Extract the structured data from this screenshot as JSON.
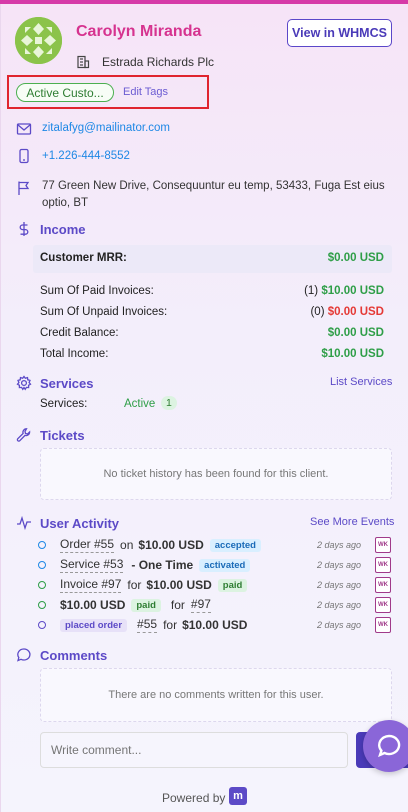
{
  "client": {
    "name": "Carolyn Miranda",
    "company": "Estrada Richards Plc",
    "view_button": "View in WHMCS",
    "tag": "Active Custo...",
    "edit_tags": "Edit Tags",
    "email": "zitalafyg@mailinator.com",
    "phone": "+1.226-444-8552",
    "address": "77 Green New Drive, Consequuntur eu temp, 53433, Fuga Est eius optio, BT"
  },
  "income": {
    "title": "Income",
    "mrr_label": "Customer MRR:",
    "mrr_value": "$0.00 USD",
    "rows": [
      {
        "label": "Sum Of Paid Invoices:",
        "count": "(1)",
        "value": "$10.00 USD",
        "color": "#2e9e47"
      },
      {
        "label": "Sum Of Unpaid Invoices:",
        "count": "(0)",
        "value": "$0.00 USD",
        "color": "#e53935"
      },
      {
        "label": "Credit Balance:",
        "count": "",
        "value": "$0.00 USD",
        "color": "#2e9e47"
      },
      {
        "label": "Total Income:",
        "count": "",
        "value": "$10.00 USD",
        "color": "#2e9e47"
      }
    ]
  },
  "services": {
    "title": "Services",
    "link": "List Services",
    "label": "Services:",
    "status": "Active",
    "count": "1"
  },
  "tickets": {
    "title": "Tickets",
    "empty": "No ticket history has been found for this client."
  },
  "activity": {
    "title": "User Activity",
    "link": "See More Events",
    "items": [
      {
        "pre": "Order #55",
        "mid": "on",
        "bold": "$10.00 USD",
        "badge": "accepted",
        "ago": "2 days ago",
        "dot": "#1e88e5"
      },
      {
        "pre": "Service #53",
        "mid": "- One Time",
        "bold": "",
        "badge": "activated",
        "ago": "2 days ago",
        "dot": "#1e88e5"
      },
      {
        "pre": "Invoice #97",
        "mid": "for",
        "bold": "$10.00 USD",
        "badge": "paid",
        "ago": "2 days ago",
        "dot": "#2e9e47"
      },
      {
        "pre": "$10.00 USD",
        "mid": "paid",
        "bold": "for",
        "badge": "#97",
        "ago": "2 days ago",
        "dot": "#2e9e47"
      },
      {
        "pre": "placed order",
        "mid": "#55",
        "bold": "for",
        "badge": "$10.00 USD",
        "ago": "2 days ago",
        "dot": "#5c4ac7"
      }
    ],
    "wk": "WK"
  },
  "comments": {
    "title": "Comments",
    "empty": "There are no comments written for this user.",
    "placeholder": "Write comment..."
  },
  "footer": {
    "powered": "Powered by",
    "logo": "m"
  }
}
